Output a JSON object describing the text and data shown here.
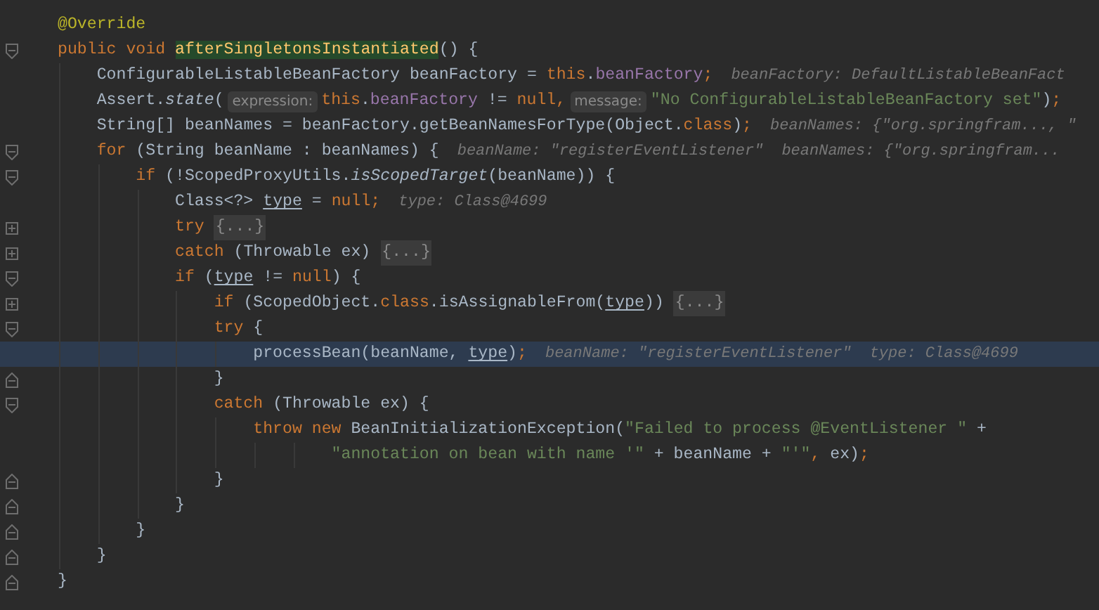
{
  "editor": {
    "lines": [
      {
        "highlighted": false,
        "tokens": [
          {
            "kind": "annotation",
            "text": "@Override"
          }
        ]
      },
      {
        "highlighted": false,
        "fold_marker": {
          "kind": "start"
        },
        "tokens": [
          {
            "kind": "keyword",
            "text": "public void "
          },
          {
            "kind": "decl",
            "text": "afterSingletonsInstantiated"
          },
          {
            "kind": "plain",
            "text": "() {"
          }
        ]
      },
      {
        "highlighted": false,
        "tokens": [
          {
            "kind": "plain",
            "text": "    ConfigurableListableBeanFactory beanFactory = "
          },
          {
            "kind": "keyword",
            "text": "this"
          },
          {
            "kind": "plain",
            "text": "."
          },
          {
            "kind": "field",
            "text": "beanFactory"
          },
          {
            "kind": "keyword",
            "text": ";"
          },
          {
            "kind": "hint",
            "text": "beanFactory: DefaultListableBeanFact"
          }
        ]
      },
      {
        "highlighted": false,
        "tokens": [
          {
            "kind": "plain",
            "text": "    Assert."
          },
          {
            "kind": "static",
            "text": "state"
          },
          {
            "kind": "plain",
            "text": "("
          },
          {
            "kind": "param_hint",
            "text": "expression:"
          },
          {
            "kind": "keyword",
            "text": "this"
          },
          {
            "kind": "plain",
            "text": "."
          },
          {
            "kind": "field",
            "text": "beanFactory"
          },
          {
            "kind": "plain",
            "text": " != "
          },
          {
            "kind": "keyword",
            "text": "null,"
          },
          {
            "kind": "param_hint",
            "text": "message:"
          },
          {
            "kind": "string",
            "text": "\"No ConfigurableListableBeanFactory set\""
          },
          {
            "kind": "plain",
            "text": ")"
          },
          {
            "kind": "keyword",
            "text": ";"
          }
        ]
      },
      {
        "highlighted": false,
        "tokens": [
          {
            "kind": "plain",
            "text": "    String[] beanNames = beanFactory.getBeanNamesForType(Object."
          },
          {
            "kind": "keyword",
            "text": "class"
          },
          {
            "kind": "plain",
            "text": ")"
          },
          {
            "kind": "keyword",
            "text": ";"
          },
          {
            "kind": "hint",
            "text": "beanNames: {\"org.springfram..., \""
          }
        ]
      },
      {
        "highlighted": false,
        "fold_marker": {
          "kind": "start"
        },
        "tokens": [
          {
            "kind": "keyword",
            "text": "    for"
          },
          {
            "kind": "plain",
            "text": " (String beanName : beanNames) {"
          },
          {
            "kind": "hint",
            "text": "beanName: \"registerEventListener\""
          },
          {
            "kind": "hint",
            "text": "beanNames: {\"org.springfram..."
          }
        ]
      },
      {
        "highlighted": false,
        "fold_marker": {
          "kind": "start"
        },
        "tokens": [
          {
            "kind": "keyword",
            "text": "        if"
          },
          {
            "kind": "plain",
            "text": " (!ScopedProxyUtils."
          },
          {
            "kind": "static",
            "text": "isScopedTarget"
          },
          {
            "kind": "plain",
            "text": "(beanName)) {"
          }
        ]
      },
      {
        "highlighted": false,
        "tokens": [
          {
            "kind": "plain",
            "text": "            Class<?> "
          },
          {
            "kind": "reassigned",
            "text": "type"
          },
          {
            "kind": "plain",
            "text": " = "
          },
          {
            "kind": "keyword",
            "text": "null;"
          },
          {
            "kind": "hint",
            "text": "type: Class@4699"
          }
        ]
      },
      {
        "highlighted": false,
        "fold_marker": {
          "kind": "collapsed"
        },
        "tokens": [
          {
            "kind": "keyword",
            "text": "            try "
          },
          {
            "kind": "folded",
            "text": "{...}"
          }
        ]
      },
      {
        "highlighted": false,
        "fold_marker": {
          "kind": "collapsed"
        },
        "tokens": [
          {
            "kind": "keyword",
            "text": "            catch"
          },
          {
            "kind": "plain",
            "text": " (Throwable ex) "
          },
          {
            "kind": "folded",
            "text": "{...}"
          }
        ]
      },
      {
        "highlighted": false,
        "fold_marker": {
          "kind": "start"
        },
        "tokens": [
          {
            "kind": "keyword",
            "text": "            if"
          },
          {
            "kind": "plain",
            "text": " ("
          },
          {
            "kind": "reassigned",
            "text": "type"
          },
          {
            "kind": "plain",
            "text": " != "
          },
          {
            "kind": "keyword",
            "text": "null"
          },
          {
            "kind": "plain",
            "text": ") {"
          }
        ]
      },
      {
        "highlighted": false,
        "fold_marker": {
          "kind": "collapsed"
        },
        "tokens": [
          {
            "kind": "keyword",
            "text": "                if"
          },
          {
            "kind": "plain",
            "text": " (ScopedObject."
          },
          {
            "kind": "keyword",
            "text": "class"
          },
          {
            "kind": "plain",
            "text": ".isAssignableFrom("
          },
          {
            "kind": "reassigned",
            "text": "type"
          },
          {
            "kind": "plain",
            "text": ")) "
          },
          {
            "kind": "folded",
            "text": "{...}"
          }
        ]
      },
      {
        "highlighted": false,
        "fold_marker": {
          "kind": "start"
        },
        "tokens": [
          {
            "kind": "keyword",
            "text": "                try"
          },
          {
            "kind": "plain",
            "text": " {"
          }
        ]
      },
      {
        "highlighted": true,
        "tokens": [
          {
            "kind": "plain",
            "text": "                    processBean(beanName, "
          },
          {
            "kind": "reassigned",
            "text": "type"
          },
          {
            "kind": "plain",
            "text": ")"
          },
          {
            "kind": "keyword",
            "text": ";"
          },
          {
            "kind": "hint",
            "text": "beanName: \"registerEventListener\""
          },
          {
            "kind": "hint",
            "text": "type: Class@4699"
          }
        ]
      },
      {
        "highlighted": false,
        "fold_marker": {
          "kind": "end"
        },
        "tokens": [
          {
            "kind": "plain",
            "text": "                }"
          }
        ]
      },
      {
        "highlighted": false,
        "fold_marker": {
          "kind": "start"
        },
        "tokens": [
          {
            "kind": "keyword",
            "text": "                catch"
          },
          {
            "kind": "plain",
            "text": " (Throwable ex) {"
          }
        ]
      },
      {
        "highlighted": false,
        "tokens": [
          {
            "kind": "keyword",
            "text": "                    throw new"
          },
          {
            "kind": "plain",
            "text": " BeanInitializationException("
          },
          {
            "kind": "string",
            "text": "\"Failed to process @EventListener \""
          },
          {
            "kind": "plain",
            "text": " +"
          }
        ]
      },
      {
        "highlighted": false,
        "tokens": [
          {
            "kind": "string",
            "text": "                            \"annotation on bean with name '\""
          },
          {
            "kind": "plain",
            "text": " + beanName + "
          },
          {
            "kind": "string",
            "text": "\"'\""
          },
          {
            "kind": "keyword",
            "text": ","
          },
          {
            "kind": "plain",
            "text": " ex)"
          },
          {
            "kind": "keyword",
            "text": ";"
          }
        ]
      },
      {
        "highlighted": false,
        "fold_marker": {
          "kind": "end"
        },
        "tokens": [
          {
            "kind": "plain",
            "text": "                }"
          }
        ]
      },
      {
        "highlighted": false,
        "fold_marker": {
          "kind": "end"
        },
        "tokens": [
          {
            "kind": "plain",
            "text": "            }"
          }
        ]
      },
      {
        "highlighted": false,
        "fold_marker": {
          "kind": "end"
        },
        "tokens": [
          {
            "kind": "plain",
            "text": "        }"
          }
        ]
      },
      {
        "highlighted": false,
        "fold_marker": {
          "kind": "end"
        },
        "tokens": [
          {
            "kind": "plain",
            "text": "    }"
          }
        ]
      },
      {
        "highlighted": false,
        "fold_marker": {
          "kind": "end"
        },
        "tokens": [
          {
            "kind": "plain",
            "text": "}"
          }
        ]
      }
    ]
  }
}
